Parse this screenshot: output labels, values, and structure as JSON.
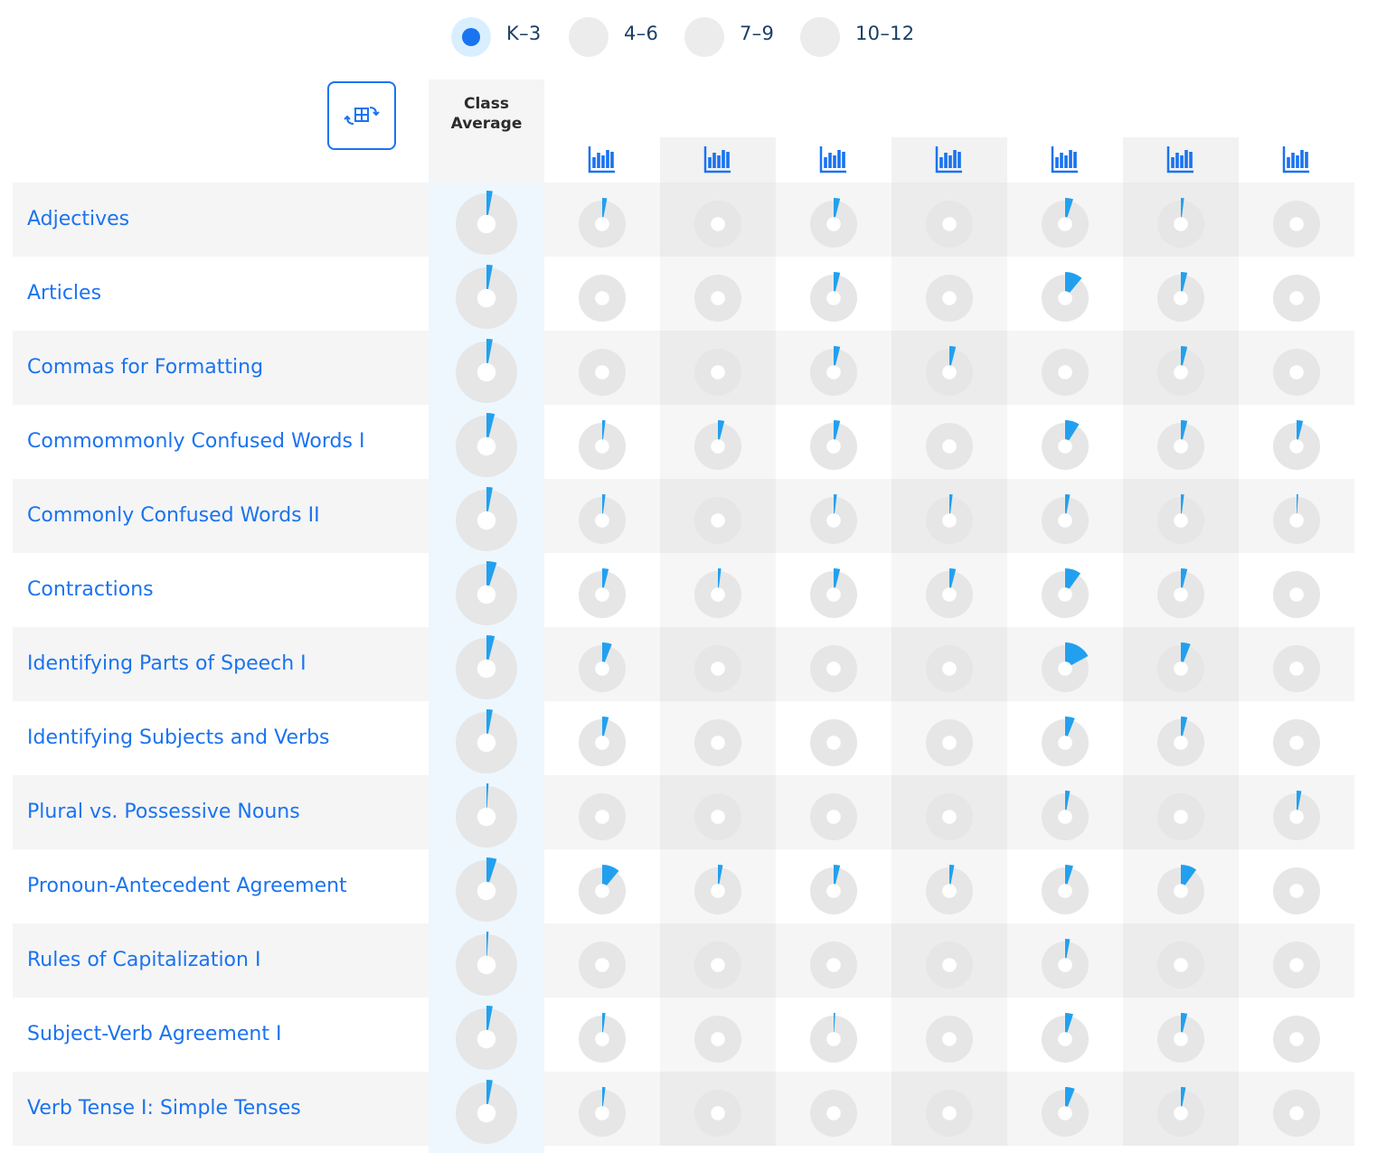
{
  "grade_levels": [
    {
      "label": "K–3",
      "selected": true
    },
    {
      "label": "4–6",
      "selected": false
    },
    {
      "label": "7–9",
      "selected": false
    },
    {
      "label": "10–12",
      "selected": false
    }
  ],
  "table": {
    "class_average_label": "Class Average",
    "student_column_icon": "bar-chart-icon",
    "swap_icon": "swap-table-icon",
    "colors": {
      "accent": "#1a73f0",
      "progress": "#22a0ef",
      "pie_base": "#e6e6e6",
      "label": "#1a73f0"
    },
    "rows": [
      {
        "label": "Adjectives",
        "class_average": 3,
        "students": [
          3,
          0,
          4,
          0,
          5,
          2,
          0
        ]
      },
      {
        "label": "Articles",
        "class_average": 3,
        "students": [
          0,
          0,
          4,
          0,
          11,
          4,
          0
        ]
      },
      {
        "label": "Commas for Formatting",
        "class_average": 3,
        "students": [
          0,
          0,
          4,
          4,
          0,
          4,
          0
        ]
      },
      {
        "label": "Commommonly Confused Words I",
        "class_average": 4,
        "students": [
          2,
          4,
          4,
          0,
          9,
          4,
          4
        ]
      },
      {
        "label": "Commonly Confused Words II",
        "class_average": 3,
        "students": [
          2,
          0,
          2,
          2,
          3,
          2,
          1
        ]
      },
      {
        "label": "Contractions",
        "class_average": 5,
        "students": [
          4,
          2,
          4,
          4,
          10,
          4,
          0
        ]
      },
      {
        "label": "Identifying Parts of Speech I",
        "class_average": 4,
        "students": [
          6,
          0,
          0,
          0,
          17,
          6,
          0
        ]
      },
      {
        "label": "Identifying Subjects and Verbs",
        "class_average": 3,
        "students": [
          4,
          0,
          0,
          0,
          6,
          4,
          0
        ]
      },
      {
        "label": "Plural vs. Possessive Nouns",
        "class_average": 1,
        "students": [
          0,
          0,
          0,
          0,
          3,
          0,
          3
        ]
      },
      {
        "label": "Pronoun-Antecedent Agreement",
        "class_average": 5,
        "students": [
          11,
          3,
          4,
          3,
          5,
          10,
          0
        ]
      },
      {
        "label": "Rules of Capitalization I",
        "class_average": 1,
        "students": [
          0,
          0,
          0,
          0,
          3,
          0,
          0
        ]
      },
      {
        "label": "Subject-Verb Agreement I",
        "class_average": 3,
        "students": [
          2,
          0,
          1,
          0,
          5,
          4,
          0
        ]
      },
      {
        "label": "Verb Tense I: Simple Tenses",
        "class_average": 3,
        "students": [
          2,
          0,
          0,
          0,
          6,
          3,
          0
        ]
      }
    ]
  }
}
